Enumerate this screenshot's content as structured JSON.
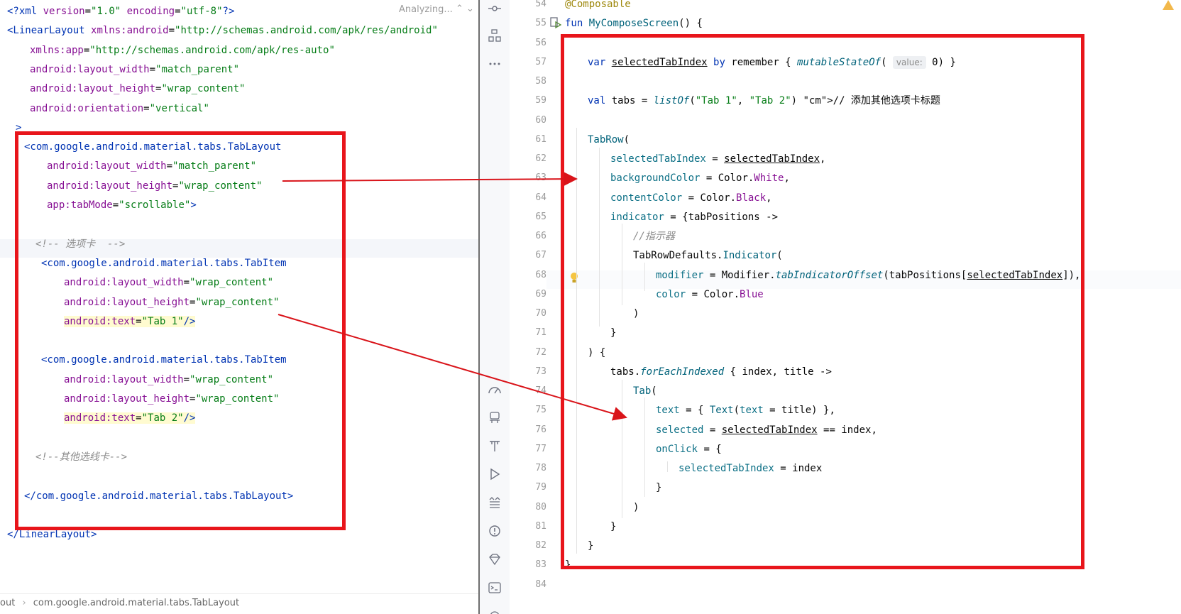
{
  "xml_editor": {
    "status": "Analyzing...",
    "lines": [
      "<?xml version=\"1.0\" encoding=\"utf-8\"?>",
      "<LinearLayout xmlns:android=\"http://schemas.android.com/apk/res/android\"",
      "xmlns:app=\"http://schemas.android.com/apk/res-auto\"",
      "android:layout_width=\"match_parent\"",
      "android:layout_height=\"wrap_content\"",
      "android:orientation=\"vertical\"",
      ">",
      "<com.google.android.material.tabs.TabLayout",
      "android:layout_width=\"match_parent\"",
      "android:layout_height=\"wrap_content\"",
      "app:tabMode=\"scrollable\">",
      "",
      "<!-- 选项卡  -->",
      "<com.google.android.material.tabs.TabItem",
      "android:layout_width=\"wrap_content\"",
      "android:layout_height=\"wrap_content\"",
      "android:text=\"Tab 1\"/>",
      "",
      "<com.google.android.material.tabs.TabItem",
      "android:layout_width=\"wrap_content\"",
      "android:layout_height=\"wrap_content\"",
      "android:text=\"Tab 2\"/>",
      "",
      "<!--其他选线卡-->",
      "",
      "</com.google.android.material.tabs.TabLayout>",
      "",
      "</LinearLayout>"
    ],
    "breadcrumb": [
      "out",
      "com.google.android.material.tabs.TabLayout"
    ]
  },
  "kotlin_editor": {
    "line_numbers": [
      "54",
      "55",
      "56",
      "57",
      "58",
      "59",
      "60",
      "61",
      "62",
      "63",
      "64",
      "65",
      "66",
      "67",
      "68",
      "69",
      "70",
      "71",
      "72",
      "73",
      "74",
      "75",
      "76",
      "77",
      "78",
      "79",
      "80",
      "81",
      "82",
      "83",
      "84"
    ],
    "param_hint": "value:",
    "lines": [
      "@Composable",
      "fun MyComposeScreen() {",
      "",
      "var selectedTabIndex by remember { mutableStateOf(0) }",
      "",
      "val tabs = listOf(\"Tab 1\", \"Tab 2\") // 添加其他选项卡标题",
      "",
      "TabRow(",
      "selectedTabIndex = selectedTabIndex,",
      "backgroundColor = Color.White,",
      "contentColor = Color.Black,",
      "indicator = {tabPositions ->",
      "//指示器",
      "TabRowDefaults.Indicator(",
      "modifier = Modifier.tabIndicatorOffset(tabPositions[selectedTabIndex]),",
      "color = Color.Blue",
      ")",
      "}",
      ") {",
      "tabs.forEachIndexed { index, title ->",
      "Tab(",
      "text = { Text(text = title) },",
      "selected = selectedTabIndex == index,",
      "onClick = {",
      "selectedTabIndex = index",
      "}",
      ")",
      "}",
      "}",
      "}",
      ""
    ]
  },
  "colors": {
    "highlight_box": "#e8151b",
    "arrow": "#d9141a",
    "tag": "#0033b3",
    "attr": "#871094",
    "string": "#067d17"
  },
  "toolbar_icons": [
    "commit-icon",
    "structure-icon",
    "more-icon",
    "profiler-icon",
    "device-manager-icon",
    "build-icon",
    "run-icon",
    "logcat-icon",
    "problems-icon",
    "gradle-icon",
    "terminal-icon",
    "services-icon"
  ]
}
